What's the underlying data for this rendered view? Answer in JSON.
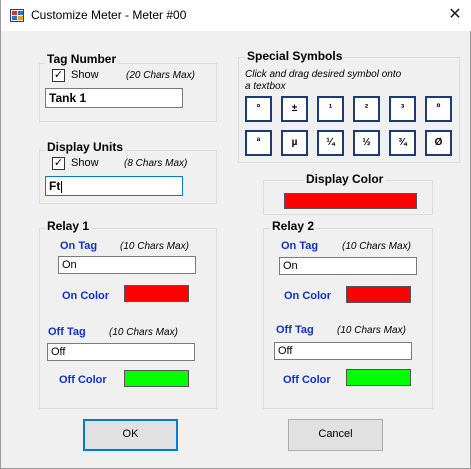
{
  "window": {
    "title": "Customize Meter - Meter #00",
    "close_glyph": "✕"
  },
  "tag_number": {
    "group_title": "Tag Number",
    "show_label": "Show",
    "show_checked": true,
    "max_note": "(20 Chars Max)",
    "value": "Tank 1"
  },
  "display_units": {
    "group_title": "Display Units",
    "show_label": "Show",
    "show_checked": true,
    "max_note": "(8 Chars Max)",
    "value": "Ft"
  },
  "special_symbols": {
    "group_title": "Special Symbols",
    "instructions_line1": "Click and drag desired symbol onto",
    "instructions_line2": "a textbox",
    "symbols": [
      "°",
      "±",
      "¹",
      "²",
      "³",
      "º",
      "ª",
      "µ",
      "¼",
      "½",
      "¾",
      "Ø"
    ]
  },
  "display_color": {
    "group_title": "Display Color",
    "color": "#ff0000"
  },
  "relay1": {
    "group_title": "Relay 1",
    "on_tag_label": "On Tag",
    "on_tag_note": "(10 Chars Max)",
    "on_tag_value": "On",
    "on_color_label": "On Color",
    "on_color": "#ff0000",
    "off_tag_label": "Off Tag",
    "off_tag_note": "(10 Chars Max)",
    "off_tag_value": "Off",
    "off_color_label": "Off Color",
    "off_color": "#00ff00"
  },
  "relay2": {
    "group_title": "Relay 2",
    "on_tag_label": "On Tag",
    "on_tag_note": "(10 Chars Max)",
    "on_tag_value": "On",
    "on_color_label": "On Color",
    "on_color": "#ff0000",
    "off_tag_label": "Off Tag",
    "off_tag_note": "(10 Chars Max)",
    "off_tag_value": "Off",
    "off_color_label": "Off Color",
    "off_color": "#00ff00"
  },
  "buttons": {
    "ok_label": "OK",
    "cancel_label": "Cancel"
  }
}
